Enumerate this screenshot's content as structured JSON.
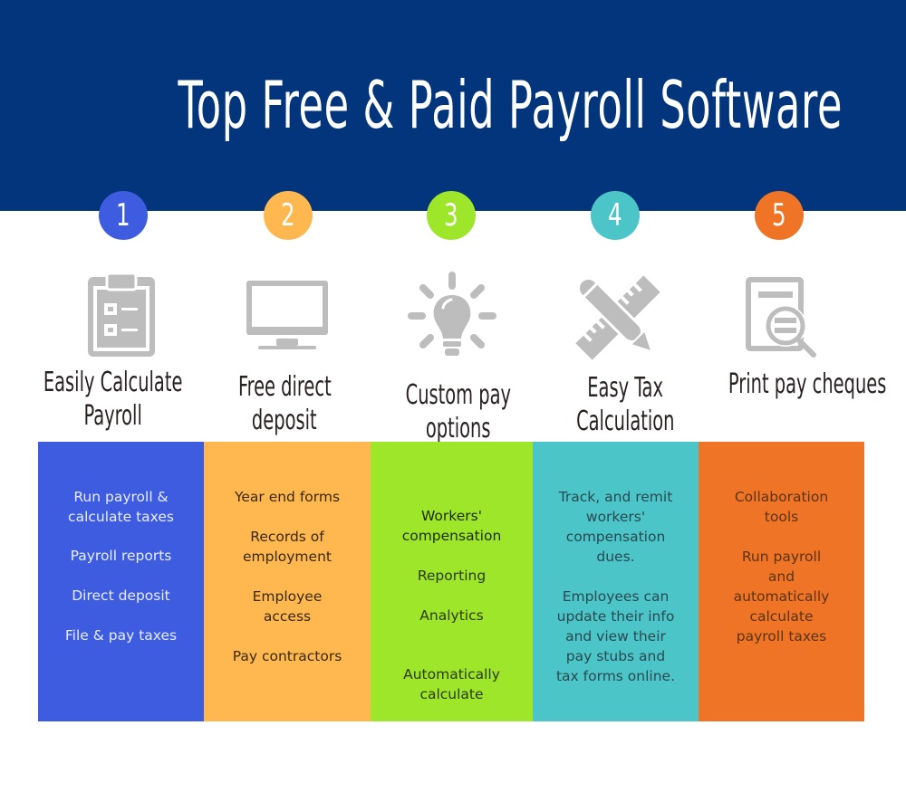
{
  "title": "Top Free & Paid Payroll Software",
  "colors": {
    "header_bg": "#03357c",
    "blue": "#3d5ce0",
    "amber": "#ffb74f",
    "green": "#9ee62a",
    "teal": "#4cc5c9",
    "orange": "#f07425",
    "icon_gray": "#bdbdbd"
  },
  "features": [
    {
      "number": "1",
      "icon": "clipboard-checklist-icon",
      "heading_lines": [
        "Easily Calculate",
        "Payroll"
      ],
      "items": [
        "Run payroll &",
        "calculate taxes",
        "Payroll reports",
        "Direct deposit",
        "File & pay taxes"
      ]
    },
    {
      "number": "2",
      "icon": "monitor-icon",
      "heading_lines": [
        "Free direct",
        "deposit"
      ],
      "items": [
        "Year end forms",
        "Records of",
        "employment",
        "Employee",
        "access",
        "Pay contractors"
      ]
    },
    {
      "number": "3",
      "icon": "lightbulb-icon",
      "heading_lines": [
        "Custom pay",
        "options"
      ],
      "items": [
        "Workers'",
        "compensation",
        "Reporting",
        "Analytics",
        "Automatically",
        "calculate"
      ]
    },
    {
      "number": "4",
      "icon": "ruler-pencil-icon",
      "heading_lines": [
        "Easy Tax",
        "Calculation"
      ],
      "items": [
        "Track, and remit",
        "workers'",
        "compensation",
        "dues.",
        "Employees can",
        "update their info",
        "and view their",
        "pay stubs and",
        "tax forms online."
      ]
    },
    {
      "number": "5",
      "icon": "document-search-icon",
      "heading_lines": [
        "Print pay cheques"
      ],
      "items": [
        "Collaboration",
        "tools",
        "Run payroll",
        "and",
        "automatically",
        "calculate",
        "payroll taxes"
      ]
    }
  ]
}
